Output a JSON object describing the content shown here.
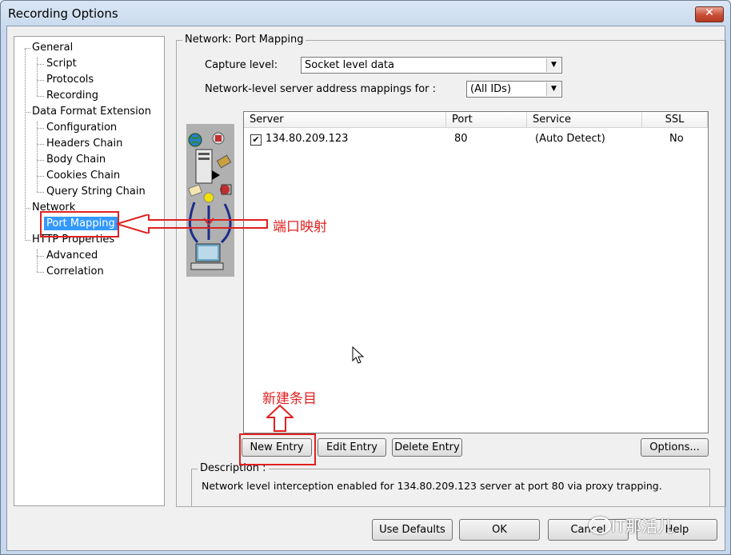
{
  "window": {
    "title": "Recording Options",
    "close_glyph": "✕"
  },
  "tree": {
    "items": [
      {
        "label": "General",
        "level": 0
      },
      {
        "label": "Script",
        "level": 1
      },
      {
        "label": "Protocols",
        "level": 1
      },
      {
        "label": "Recording",
        "level": 1
      },
      {
        "label": "Data Format Extension",
        "level": 0
      },
      {
        "label": "Configuration",
        "level": 1
      },
      {
        "label": "Headers Chain",
        "level": 1
      },
      {
        "label": "Body Chain",
        "level": 1
      },
      {
        "label": "Cookies Chain",
        "level": 1
      },
      {
        "label": "Query String Chain",
        "level": 1
      },
      {
        "label": "Network",
        "level": 0
      },
      {
        "label": "Port Mapping",
        "level": 1,
        "selected": true
      },
      {
        "label": "HTTP Properties",
        "level": 0
      },
      {
        "label": "Advanced",
        "level": 1
      },
      {
        "label": "Correlation",
        "level": 1
      }
    ]
  },
  "panel": {
    "title": "Network: Port Mapping",
    "capture_label": "Capture level:",
    "capture_value": "Socket level data",
    "mapping_label": "Network-level server address mappings for :",
    "mapping_value": "(All IDs)"
  },
  "table": {
    "columns": [
      "Server",
      "Port",
      "Service",
      "SSL"
    ],
    "rows": [
      {
        "checked": true,
        "server": "134.80.209.123",
        "port": "80",
        "service": "(Auto Detect)",
        "ssl": "No"
      }
    ]
  },
  "buttons": {
    "new_entry": "New Entry",
    "edit_entry": "Edit Entry",
    "delete_entry": "Delete Entry",
    "options": "Options...",
    "use_defaults": "Use Defaults",
    "ok": "OK",
    "cancel": "Cancel",
    "help": "Help"
  },
  "description": {
    "title": "Description :",
    "text": "Network level interception enabled for 134.80.209.123 server at port 80 via proxy trapping."
  },
  "annotations": {
    "port_mapping": "端口映射",
    "new_entry": "新建条目",
    "color": "#e02020"
  },
  "watermark": "IT那活儿",
  "check_glyph": "✔",
  "combo_arrow": "▼"
}
